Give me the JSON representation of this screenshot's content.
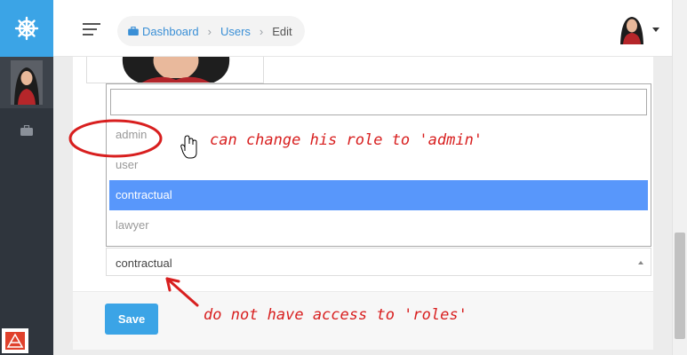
{
  "sidebar": {
    "logo_icon": "ship-wheel-icon",
    "avatar_icon": "user-avatar",
    "nav_icon": "briefcase-icon",
    "taskbar_icon": "app-icon"
  },
  "header": {
    "breadcrumb": [
      {
        "label": "Dashboard",
        "icon": "briefcase-icon"
      },
      {
        "label": "Users"
      },
      {
        "label": "Edit"
      }
    ],
    "user_avatar": "user-avatar"
  },
  "form": {
    "role_dropdown": {
      "search_value": "",
      "options": [
        "admin",
        "user",
        "contractual",
        "lawyer"
      ],
      "highlighted": "contractual"
    },
    "role_select": {
      "value": "contractual"
    },
    "save_label": "Save"
  },
  "annotations": {
    "top": "can change his role to 'admin'",
    "bottom": "do not have access to 'roles'"
  },
  "colors": {
    "accent": "#3ba4e6",
    "sidebar": "#2f353d",
    "highlight": "#5897fb",
    "annotation": "#d81f1f",
    "link": "#3a8fd6"
  }
}
